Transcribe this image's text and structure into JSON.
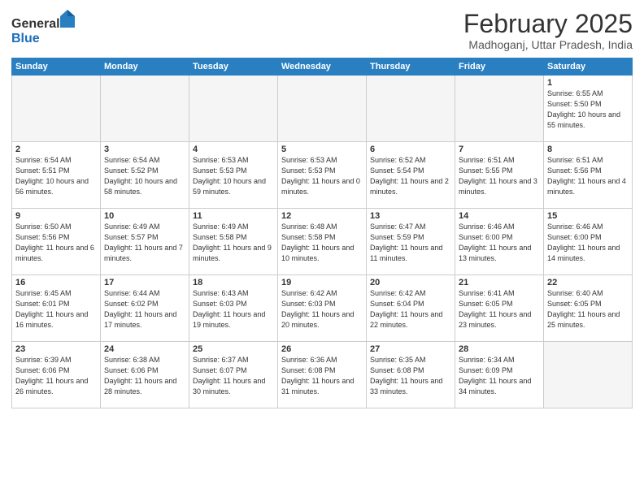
{
  "header": {
    "logo_general": "General",
    "logo_blue": "Blue",
    "month_title": "February 2025",
    "location": "Madhoganj, Uttar Pradesh, India"
  },
  "weekdays": [
    "Sunday",
    "Monday",
    "Tuesday",
    "Wednesday",
    "Thursday",
    "Friday",
    "Saturday"
  ],
  "weeks": [
    [
      {
        "day": "",
        "empty": true
      },
      {
        "day": "",
        "empty": true
      },
      {
        "day": "",
        "empty": true
      },
      {
        "day": "",
        "empty": true
      },
      {
        "day": "",
        "empty": true
      },
      {
        "day": "",
        "empty": true
      },
      {
        "day": "1",
        "sunrise": "6:55 AM",
        "sunset": "5:50 PM",
        "daylight": "10 hours and 55 minutes."
      }
    ],
    [
      {
        "day": "2",
        "sunrise": "6:54 AM",
        "sunset": "5:51 PM",
        "daylight": "10 hours and 56 minutes."
      },
      {
        "day": "3",
        "sunrise": "6:54 AM",
        "sunset": "5:52 PM",
        "daylight": "10 hours and 58 minutes."
      },
      {
        "day": "4",
        "sunrise": "6:53 AM",
        "sunset": "5:53 PM",
        "daylight": "10 hours and 59 minutes."
      },
      {
        "day": "5",
        "sunrise": "6:53 AM",
        "sunset": "5:53 PM",
        "daylight": "11 hours and 0 minutes."
      },
      {
        "day": "6",
        "sunrise": "6:52 AM",
        "sunset": "5:54 PM",
        "daylight": "11 hours and 2 minutes."
      },
      {
        "day": "7",
        "sunrise": "6:51 AM",
        "sunset": "5:55 PM",
        "daylight": "11 hours and 3 minutes."
      },
      {
        "day": "8",
        "sunrise": "6:51 AM",
        "sunset": "5:56 PM",
        "daylight": "11 hours and 4 minutes."
      }
    ],
    [
      {
        "day": "9",
        "sunrise": "6:50 AM",
        "sunset": "5:56 PM",
        "daylight": "11 hours and 6 minutes."
      },
      {
        "day": "10",
        "sunrise": "6:49 AM",
        "sunset": "5:57 PM",
        "daylight": "11 hours and 7 minutes."
      },
      {
        "day": "11",
        "sunrise": "6:49 AM",
        "sunset": "5:58 PM",
        "daylight": "11 hours and 9 minutes."
      },
      {
        "day": "12",
        "sunrise": "6:48 AM",
        "sunset": "5:58 PM",
        "daylight": "11 hours and 10 minutes."
      },
      {
        "day": "13",
        "sunrise": "6:47 AM",
        "sunset": "5:59 PM",
        "daylight": "11 hours and 11 minutes."
      },
      {
        "day": "14",
        "sunrise": "6:46 AM",
        "sunset": "6:00 PM",
        "daylight": "11 hours and 13 minutes."
      },
      {
        "day": "15",
        "sunrise": "6:46 AM",
        "sunset": "6:00 PM",
        "daylight": "11 hours and 14 minutes."
      }
    ],
    [
      {
        "day": "16",
        "sunrise": "6:45 AM",
        "sunset": "6:01 PM",
        "daylight": "11 hours and 16 minutes."
      },
      {
        "day": "17",
        "sunrise": "6:44 AM",
        "sunset": "6:02 PM",
        "daylight": "11 hours and 17 minutes."
      },
      {
        "day": "18",
        "sunrise": "6:43 AM",
        "sunset": "6:03 PM",
        "daylight": "11 hours and 19 minutes."
      },
      {
        "day": "19",
        "sunrise": "6:42 AM",
        "sunset": "6:03 PM",
        "daylight": "11 hours and 20 minutes."
      },
      {
        "day": "20",
        "sunrise": "6:42 AM",
        "sunset": "6:04 PM",
        "daylight": "11 hours and 22 minutes."
      },
      {
        "day": "21",
        "sunrise": "6:41 AM",
        "sunset": "6:05 PM",
        "daylight": "11 hours and 23 minutes."
      },
      {
        "day": "22",
        "sunrise": "6:40 AM",
        "sunset": "6:05 PM",
        "daylight": "11 hours and 25 minutes."
      }
    ],
    [
      {
        "day": "23",
        "sunrise": "6:39 AM",
        "sunset": "6:06 PM",
        "daylight": "11 hours and 26 minutes."
      },
      {
        "day": "24",
        "sunrise": "6:38 AM",
        "sunset": "6:06 PM",
        "daylight": "11 hours and 28 minutes."
      },
      {
        "day": "25",
        "sunrise": "6:37 AM",
        "sunset": "6:07 PM",
        "daylight": "11 hours and 30 minutes."
      },
      {
        "day": "26",
        "sunrise": "6:36 AM",
        "sunset": "6:08 PM",
        "daylight": "11 hours and 31 minutes."
      },
      {
        "day": "27",
        "sunrise": "6:35 AM",
        "sunset": "6:08 PM",
        "daylight": "11 hours and 33 minutes."
      },
      {
        "day": "28",
        "sunrise": "6:34 AM",
        "sunset": "6:09 PM",
        "daylight": "11 hours and 34 minutes."
      },
      {
        "day": "",
        "empty": true
      }
    ]
  ]
}
